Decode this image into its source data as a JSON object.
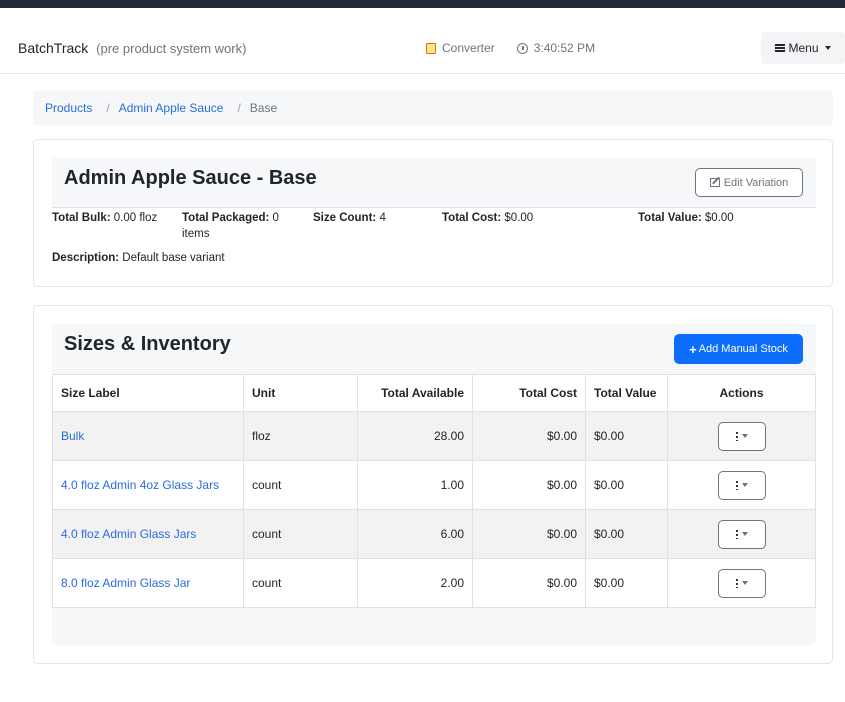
{
  "app": {
    "brand": "BatchTrack",
    "brand_sub": "(pre product system work)",
    "converter_label": "Converter",
    "clock": "3:40:52 PM",
    "menu_label": "Menu"
  },
  "breadcrumb": {
    "items": [
      "Products",
      "Admin Apple Sauce"
    ],
    "current": "Base"
  },
  "variation": {
    "title": "Admin Apple Sauce - Base",
    "edit_label": "Edit Variation",
    "stats": [
      {
        "label": "Total Bulk:",
        "value": "0.00 floz"
      },
      {
        "label": "Total Packaged:",
        "value": "0 items"
      },
      {
        "label": "Size Count:",
        "value": "4"
      },
      {
        "label": "Total Cost:",
        "value": "$0.00"
      },
      {
        "label": "Total Value:",
        "value": "$0.00"
      }
    ],
    "description_label": "Description:",
    "description": "Default base variant"
  },
  "inventory": {
    "title": "Sizes & Inventory",
    "add_label": "Add Manual Stock",
    "columns": [
      "Size Label",
      "Unit",
      "Total Available",
      "Total Cost",
      "Total Value",
      "Actions"
    ],
    "rows": [
      {
        "label": "Bulk",
        "unit": "floz",
        "available": "28.00",
        "cost": "$0.00",
        "value": "$0.00"
      },
      {
        "label": "4.0 floz Admin 4oz Glass Jars",
        "unit": "count",
        "available": "1.00",
        "cost": "$0.00",
        "value": "$0.00"
      },
      {
        "label": "4.0 floz Admin Glass Jars",
        "unit": "count",
        "available": "6.00",
        "cost": "$0.00",
        "value": "$0.00"
      },
      {
        "label": "8.0 floz Admin Glass Jar",
        "unit": "count",
        "available": "2.00",
        "cost": "$0.00",
        "value": "$0.00"
      }
    ]
  },
  "colors": {
    "primary": "#0d6efd",
    "link": "#2b6cdb",
    "topbar": "#1f2937"
  },
  "icons": [
    "converter-icon",
    "clock-icon",
    "hamburger-icon",
    "edit-icon",
    "plus-icon",
    "kebab-icon",
    "chevron-down-icon"
  ]
}
